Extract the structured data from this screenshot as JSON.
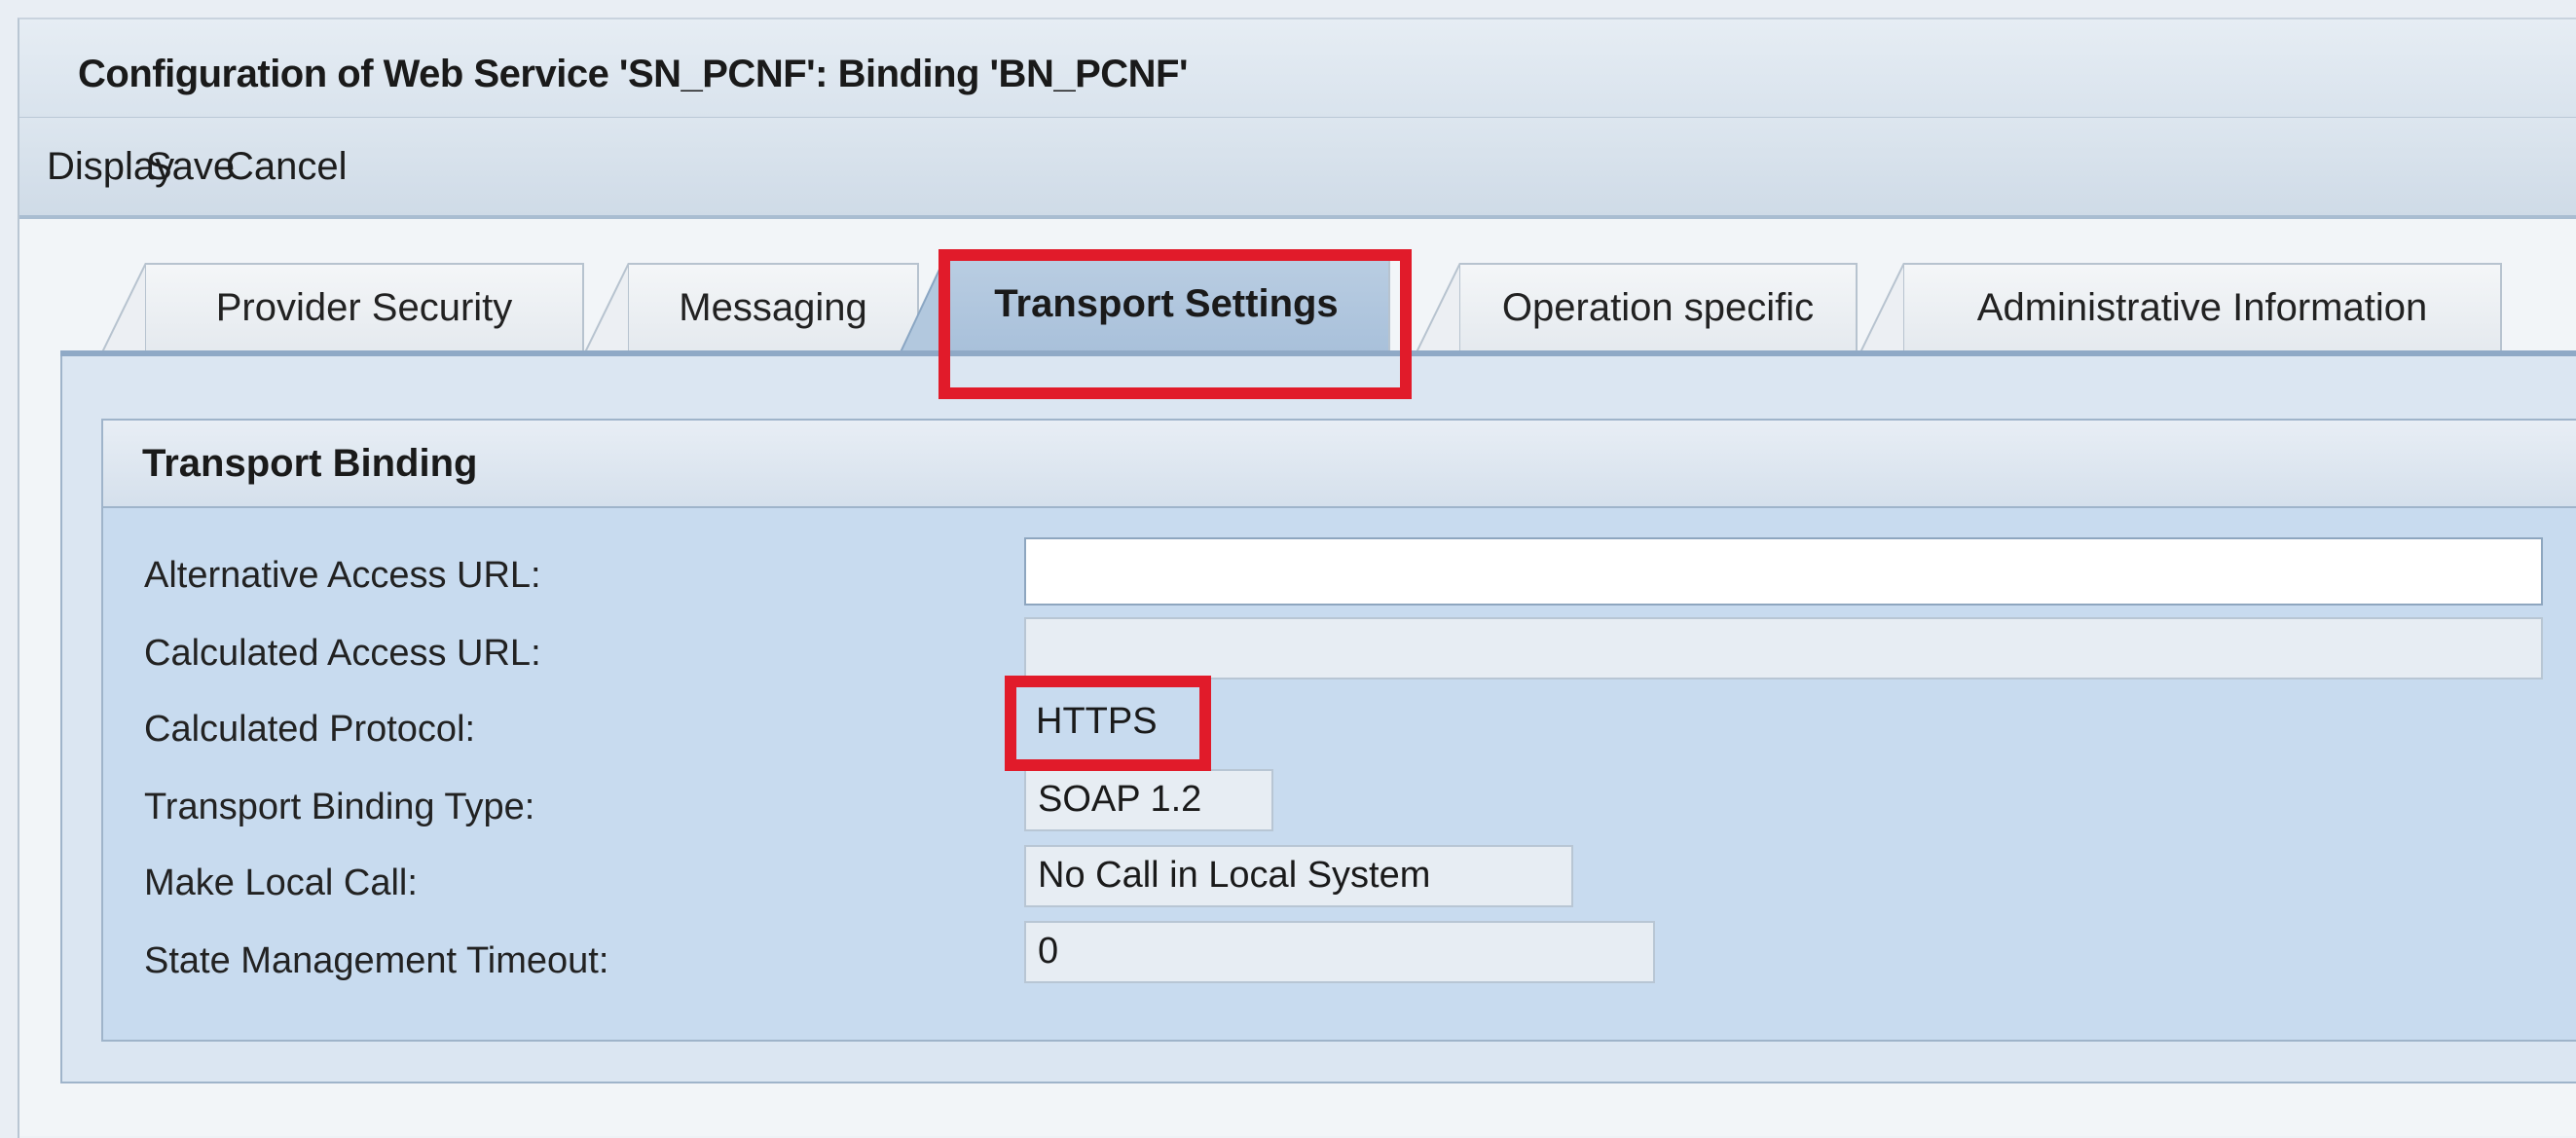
{
  "window": {
    "title": "Configuration of Web Service 'SN_PCNF': Binding 'BN_PCNF'"
  },
  "toolbar": {
    "display_label": "Display",
    "save_label": "Save",
    "cancel_label": "Cancel"
  },
  "tabs": [
    {
      "label": "Provider Security",
      "active": false
    },
    {
      "label": "Messaging",
      "active": false
    },
    {
      "label": "Transport Settings",
      "active": true
    },
    {
      "label": "Operation specific",
      "active": false
    },
    {
      "label": "Administrative Information",
      "active": false
    }
  ],
  "group": {
    "title": "Transport Binding",
    "fields": [
      {
        "label": "Alternative Access URL:",
        "value": "",
        "editable": true
      },
      {
        "label": "Calculated Access URL:",
        "value": "",
        "editable": false
      },
      {
        "label": "Calculated Protocol:",
        "value": "HTTPS",
        "editable": false
      },
      {
        "label": "Transport Binding Type:",
        "value": "SOAP 1.2",
        "editable": false
      },
      {
        "label": "Make Local Call:",
        "value": "No Call in Local System",
        "editable": false
      },
      {
        "label": "State Management Timeout:",
        "value": "0",
        "editable": false
      }
    ]
  },
  "colors": {
    "highlight": "#e11b2a",
    "active_tab": "#b9cde2",
    "group_body": "#c8dbef"
  }
}
